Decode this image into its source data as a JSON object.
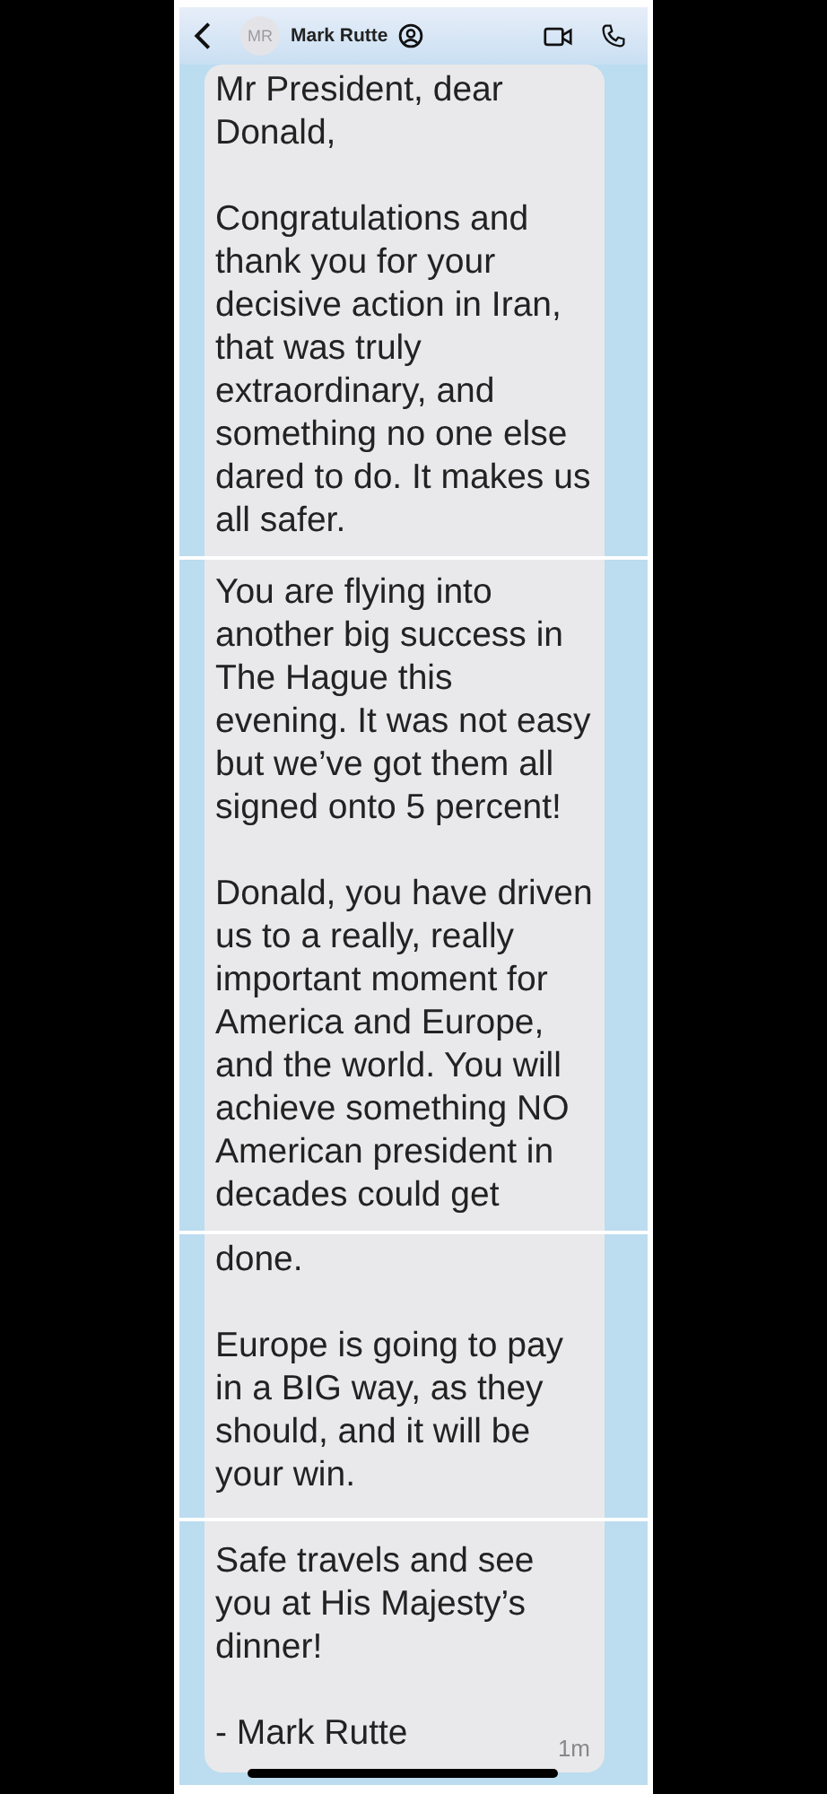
{
  "header": {
    "avatar_initials": "MR",
    "contact_name": "Mark Rutte"
  },
  "segments": [
    {
      "paragraphs": [
        "Mr President, dear Donald,",
        "Congratulations and thank you for your decisive action in Iran, that was truly extraordinary, and something no one else dared to do.  It makes us all safer."
      ]
    },
    {
      "paragraphs": [
        "You are flying into another big success in The Hague this evening. It was not easy but we’ve got them all signed onto 5 percent!",
        "Donald, you have driven us to a really, really important moment for America and Europe, and the world.  You will achieve something NO American president in decades could get"
      ]
    },
    {
      "paragraphs": [
        "done.",
        "Europe is going to pay in a BIG way, as they should, and it will be your win."
      ]
    },
    {
      "paragraphs": [
        "Safe travels and see you at His Majesty’s dinner!",
        "- Mark Rutte"
      ],
      "time": "1m"
    }
  ]
}
